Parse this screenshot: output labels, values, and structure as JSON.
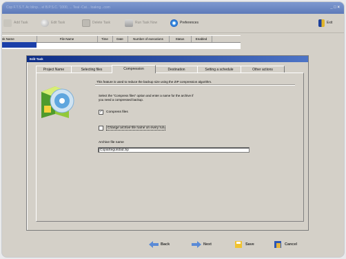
{
  "window": {
    "title": "Cop F.T.S.T. Ac blinp... el B.P.S.C. '1000, ... Teal -Cat... loakng...com",
    "controls": "_ □ ×"
  },
  "toolbar": {
    "items": [
      {
        "label": "Add Task",
        "icon": "add-task-icon",
        "active": false
      },
      {
        "label": "Edit Task",
        "icon": "edit-task-icon",
        "active": false
      },
      {
        "label": "Delete Task",
        "icon": "delete-task-icon",
        "active": false
      },
      {
        "label": "Run Task Now",
        "icon": "run-task-icon",
        "active": false
      },
      {
        "label": "Preferences",
        "icon": "preferences-icon",
        "active": true
      },
      {
        "label": "Exit",
        "icon": "exit-icon",
        "active": true
      }
    ]
  },
  "grid": {
    "columns": [
      "sk Name",
      "File Name",
      "Time",
      "Date",
      "Number of executions",
      "Status",
      "Enabled"
    ]
  },
  "dialog": {
    "title": "Edit Task",
    "tabs": [
      "Project Name",
      "Selecting files",
      "Compression",
      "Destination",
      "Setting a schedule",
      "Other actions"
    ],
    "selected_tab": "Compression",
    "description": "This feature is used to reduce the backup size using the ZIP compression algorithm.",
    "hint": "Select the \"Compress files\" option and enter a name for the archive if you need a compressed backup.",
    "compress_label": "Compress files",
    "compress_checked": "✓",
    "change_name_label": "Change archive file name on every run",
    "change_name_checked": "",
    "archive_label": "Archive file name",
    "archive_value": "CopiaSeguridad.zip"
  },
  "buttons": {
    "back": "Back",
    "next": "Next",
    "save": "Save",
    "cancel": "Cancel"
  },
  "colors": {
    "accent": "#1b3fa9",
    "dialog_title": "#0d2d86"
  }
}
